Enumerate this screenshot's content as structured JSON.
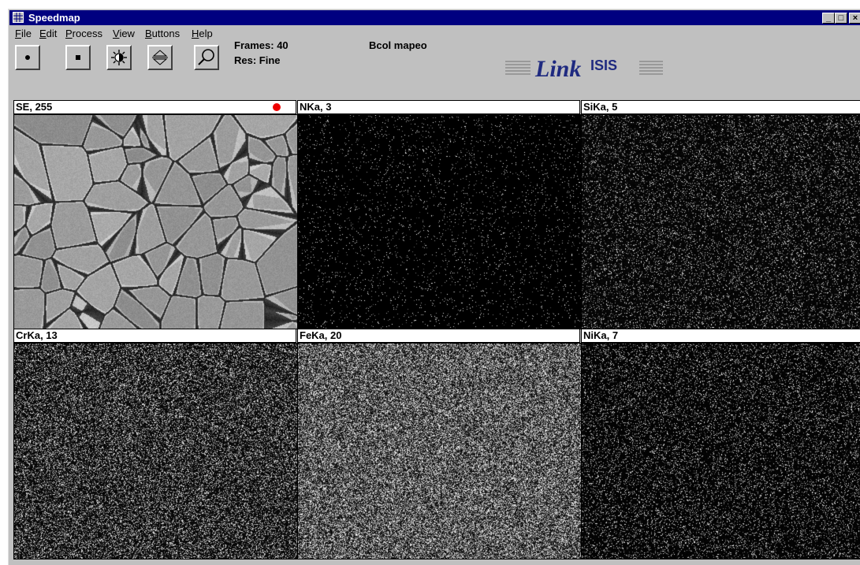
{
  "window": {
    "title": "Speedmap",
    "controls": [
      "_",
      "□",
      "×"
    ]
  },
  "menu": [
    {
      "u": "F",
      "rest": "ile"
    },
    {
      "u": "E",
      "rest": "dit"
    },
    {
      "u": "P",
      "rest": "rocess"
    },
    {
      "u": "V",
      "rest": "iew"
    },
    {
      "u": "B",
      "rest": "uttons"
    },
    {
      "u": "H",
      "rest": "elp"
    }
  ],
  "toolbar": {
    "buttons": [
      "start-icon",
      "stop-icon",
      "brightness-icon",
      "contrast-arrows-icon",
      "zoom-icon"
    ]
  },
  "status": {
    "frames": "Frames:  40",
    "res": "Res: Fine",
    "project": "Bcol mapeo"
  },
  "logo": {
    "word1": "Link",
    "word2": "ISIS"
  },
  "panels": [
    {
      "label": "SE, 255",
      "type": "se",
      "recording": true
    },
    {
      "label": "NKa, 3",
      "type": "noise",
      "density": 0.035,
      "level": 0
    },
    {
      "label": "SiKa, 5",
      "type": "noise",
      "density": 0.12,
      "level": 12
    },
    {
      "label": "CrKa, 13",
      "type": "noise",
      "density": 0.3,
      "level": 20
    },
    {
      "label": "FeKa, 20",
      "type": "noise",
      "density": 0.5,
      "level": 45
    },
    {
      "label": "NiKa, 7",
      "type": "noise",
      "density": 0.14,
      "level": 8
    }
  ],
  "colors": {
    "titlebar": "#000080",
    "face": "#c0c0c0",
    "logo": "#1f2a80",
    "recording": "#ee0000"
  }
}
